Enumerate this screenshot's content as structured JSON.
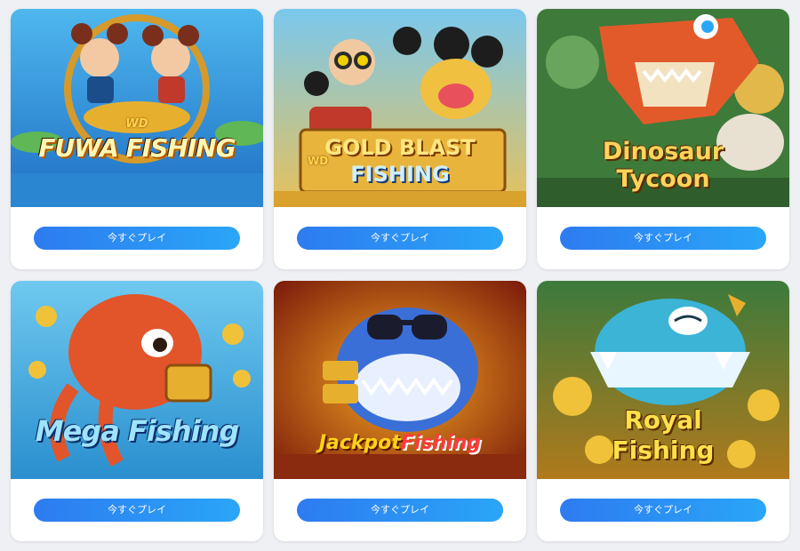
{
  "colors": {
    "page_bg": "#eef0f4",
    "card_bg": "#ffffff",
    "button_start": "#2d7bf0",
    "button_end": "#2aa6f7"
  },
  "games": [
    {
      "logo_small": "WD",
      "title": "FUWA FISHING",
      "button_label": "今すぐプレイ"
    },
    {
      "logo_small": "WD",
      "title_line1": "GOLD BLAST",
      "title_line2": "FISHING",
      "button_label": "今すぐプレイ"
    },
    {
      "title_line1": "Dinosaur",
      "title_line2": "Tycoon",
      "button_label": "今すぐプレイ"
    },
    {
      "title": "Mega Fishing",
      "button_label": "今すぐプレイ"
    },
    {
      "title_part1": "Jackpot",
      "title_part2": "Fishing",
      "button_label": "今すぐプレイ"
    },
    {
      "title_line1": "Royal",
      "title_line2": "Fishing",
      "button_label": "今すぐプレイ"
    }
  ]
}
